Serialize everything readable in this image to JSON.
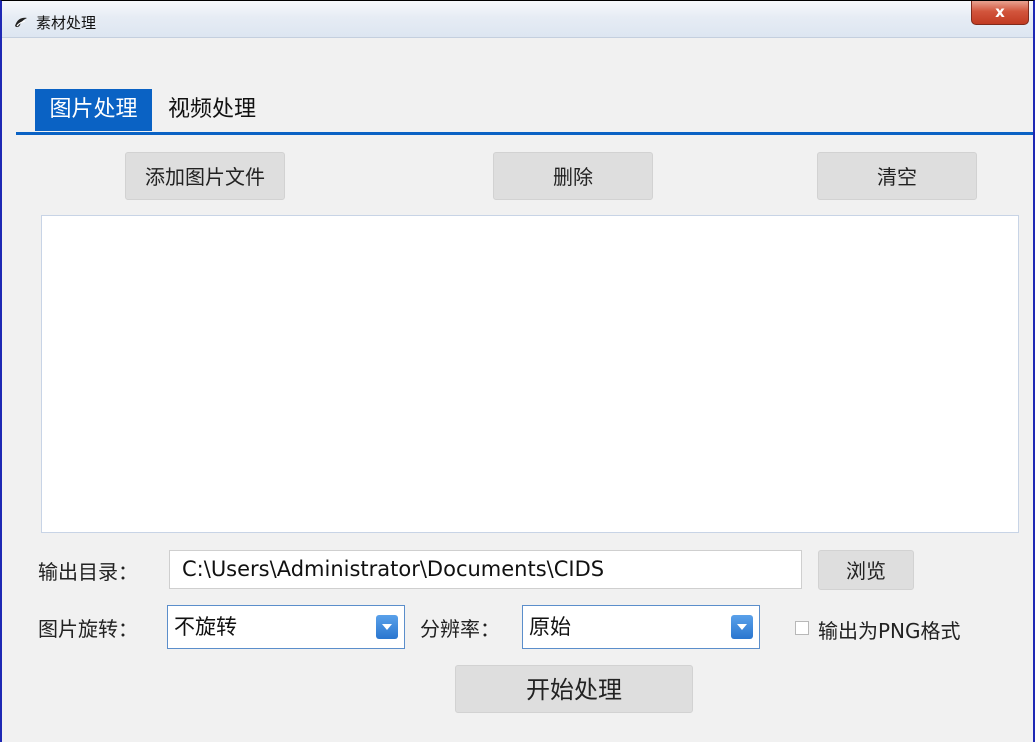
{
  "window": {
    "title": "素材处理",
    "close_label": "x"
  },
  "tabs": [
    {
      "label": "图片处理",
      "active": true
    },
    {
      "label": "视频处理",
      "active": false
    }
  ],
  "toolbar": {
    "add_label": "添加图片文件",
    "delete_label": "删除",
    "clear_label": "清空"
  },
  "file_list": {
    "items": []
  },
  "output": {
    "label": "输出目录：",
    "path": "C:\\Users\\Administrator\\Documents\\CIDS",
    "browse_label": "浏览"
  },
  "rotation": {
    "label": "图片旋转：",
    "selected": "不旋转"
  },
  "resolution": {
    "label": "分辨率：",
    "selected": "原始"
  },
  "png_option": {
    "label": "输出为PNG格式",
    "checked": false
  },
  "start_label": "开始处理",
  "colors": {
    "accent": "#0a62c4",
    "window_border": "#1e28b4",
    "close": "#c84a30"
  }
}
